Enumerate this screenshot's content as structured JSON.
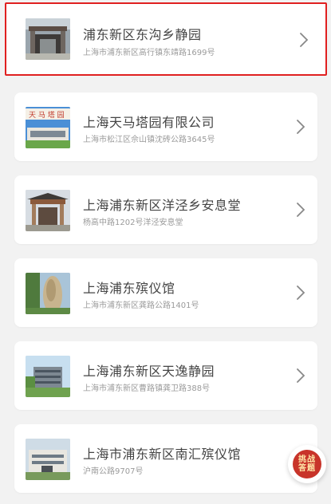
{
  "items": [
    {
      "title": "浦东新区东沟乡静园",
      "address": "上海市浦东新区高行镇东靖路1699号",
      "thumb": "gate"
    },
    {
      "title": "上海天马塔园有限公司",
      "address": "上海市松江区佘山镇沈砖公路3645号",
      "thumb": "building-sign"
    },
    {
      "title": "上海浦东新区洋泾乡安息堂",
      "address": "杨高中路1202号洋泾安息堂",
      "thumb": "pavilion"
    },
    {
      "title": "上海浦东殡仪馆",
      "address": "上海市浦东新区龚路公路1401号",
      "thumb": "stone"
    },
    {
      "title": "上海浦东新区天逸静园",
      "address": "上海市浦东新区曹路镇龚卫路388号",
      "thumb": "modern-building"
    },
    {
      "title": "上海市浦东新区南汇殡仪馆",
      "address": "沪南公路9707号",
      "thumb": "hall"
    }
  ],
  "fab": {
    "label_line1": "挑战",
    "label_line2": "答题"
  },
  "colors": {
    "accent": "#e02020",
    "fab": "#c8342a"
  }
}
